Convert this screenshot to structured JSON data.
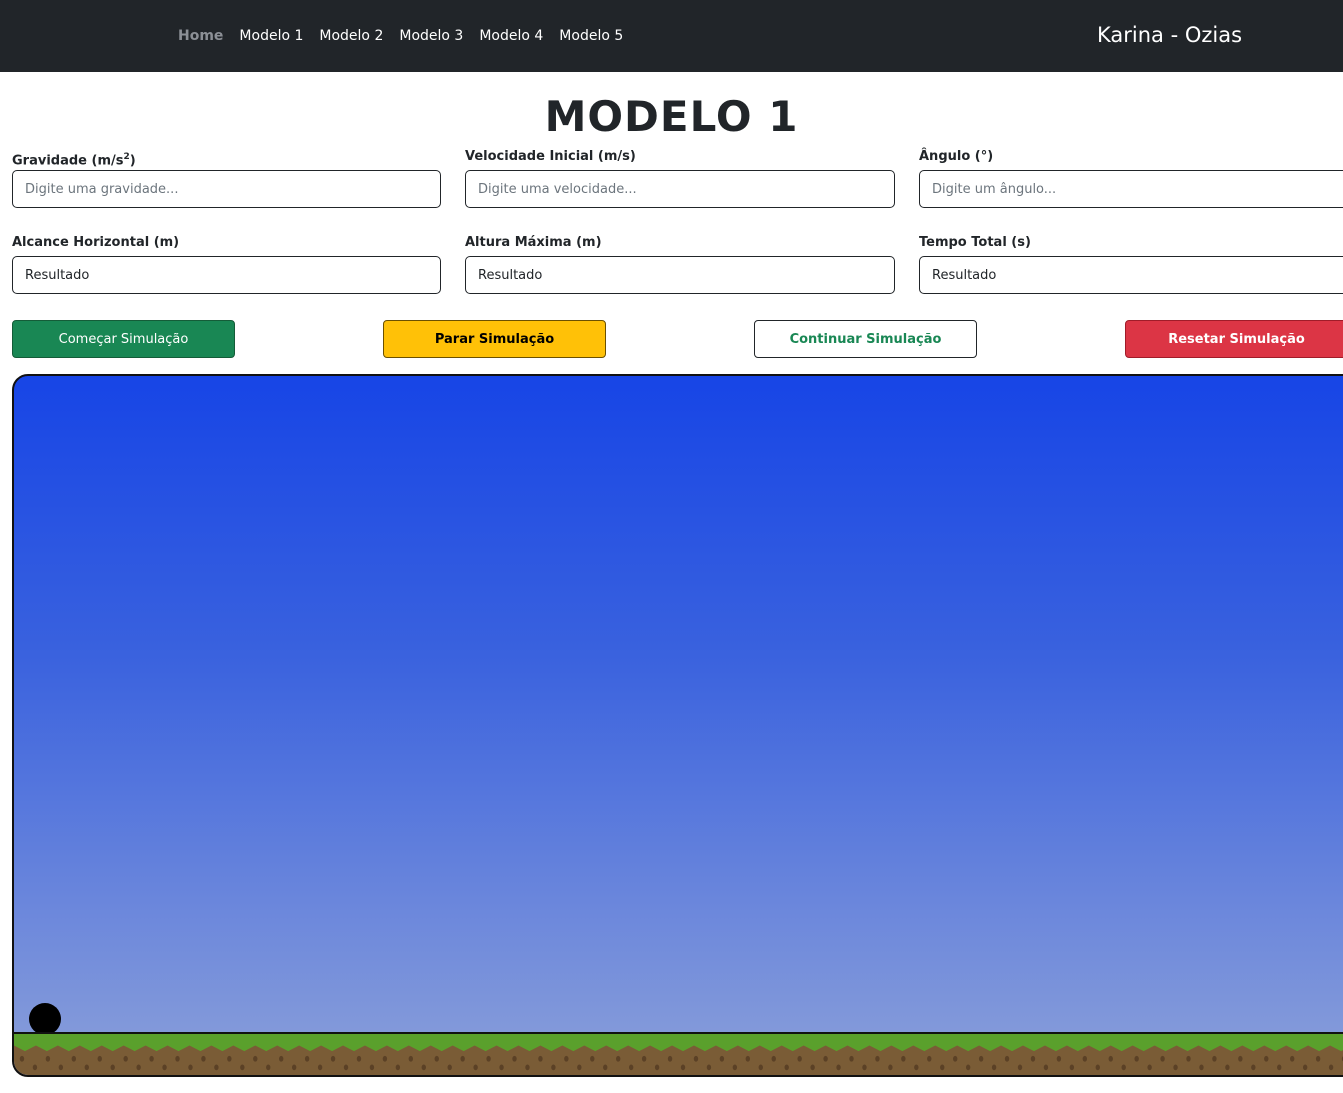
{
  "navbar": {
    "links": [
      {
        "label": "Home",
        "active": true
      },
      {
        "label": "Modelo 1",
        "active": false
      },
      {
        "label": "Modelo 2",
        "active": false
      },
      {
        "label": "Modelo 3",
        "active": false
      },
      {
        "label": "Modelo 4",
        "active": false
      },
      {
        "label": "Modelo 5",
        "active": false
      }
    ],
    "brand": "Karina - Ozias"
  },
  "page_title": "MODELO 1",
  "inputs": {
    "gravity": {
      "label": "Gravidade (m/s",
      "label_sup": "2",
      "label_end": ")",
      "placeholder": "Digite uma gravidade...",
      "value": ""
    },
    "velocity": {
      "label": "Velocidade Inicial (m/s)",
      "placeholder": "Digite uma velocidade...",
      "value": ""
    },
    "angle": {
      "label": "Ângulo (°)",
      "placeholder": "Digite um ângulo...",
      "value": ""
    }
  },
  "results": {
    "range": {
      "label": "Alcance Horizontal (m)",
      "value": "Resultado"
    },
    "max_height": {
      "label": "Altura Máxima (m)",
      "value": "Resultado"
    },
    "total_time": {
      "label": "Tempo Total (s)",
      "value": "Resultado"
    }
  },
  "buttons": {
    "start": "Começar Simulação",
    "stop": "Parar Simulação",
    "continue": "Continuar Simulação",
    "reset": "Resetar Simulação"
  },
  "colors": {
    "navbar_bg": "#212529",
    "sky_top": "#1745e6",
    "sky_bottom": "#8a9fd9",
    "grass": "#5aa02c",
    "dirt": "#7a5c36",
    "start_btn": "#198754",
    "stop_btn": "#ffc107",
    "reset_btn": "#dc3545"
  }
}
